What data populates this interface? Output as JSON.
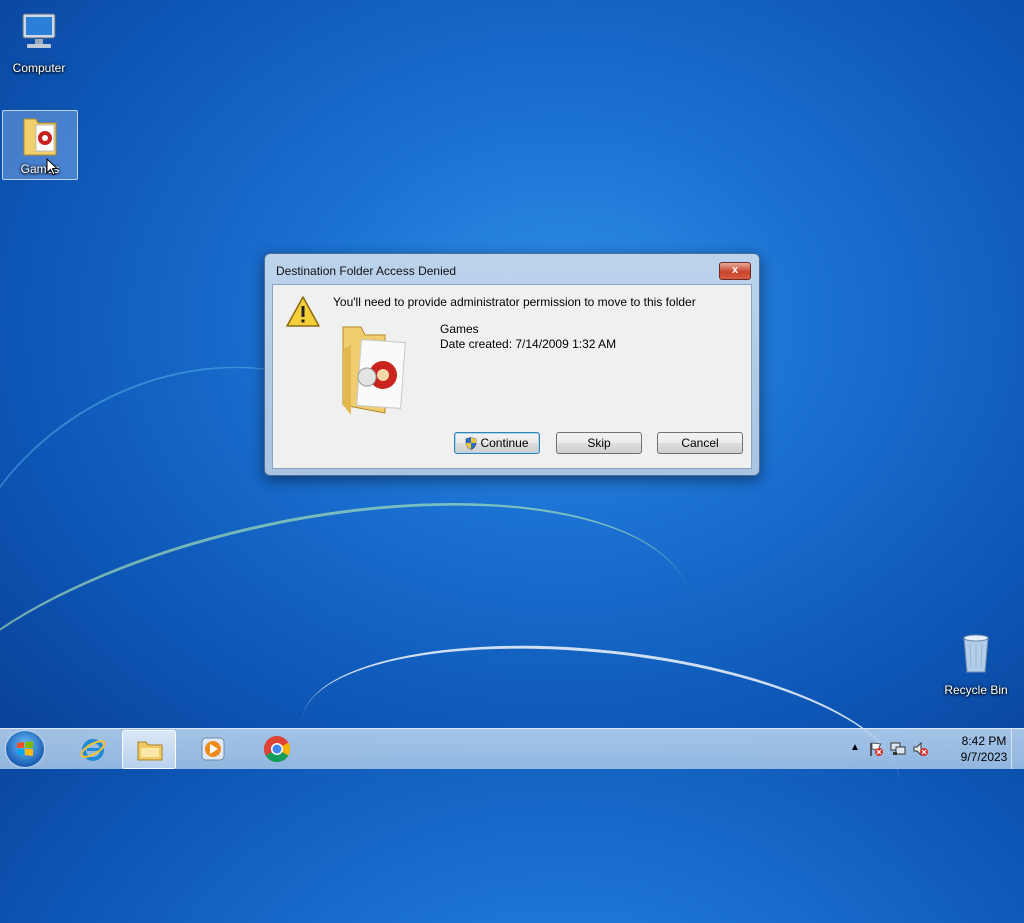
{
  "desktop": {
    "icons": [
      {
        "label": "Computer"
      },
      {
        "label": "Games"
      },
      {
        "label": "Recycle Bin"
      }
    ]
  },
  "dialog": {
    "title": "Destination Folder Access Denied",
    "message": "You'll need to provide administrator permission to move to this folder",
    "item_name": "Games",
    "item_date": "Date created: 7/14/2009 1:32 AM",
    "close_label": "x",
    "buttons": {
      "continue": "Continue",
      "skip": "Skip",
      "cancel": "Cancel"
    }
  },
  "taskbar": {
    "pinned": [
      "internet-explorer",
      "windows-explorer",
      "windows-media-player",
      "google-chrome"
    ],
    "tray": {
      "overflow": "▲",
      "time": "8:42 PM",
      "date": "9/7/2023"
    }
  },
  "icons": {
    "warning": "warning-triangle-icon",
    "shield": "uac-shield-icon"
  }
}
